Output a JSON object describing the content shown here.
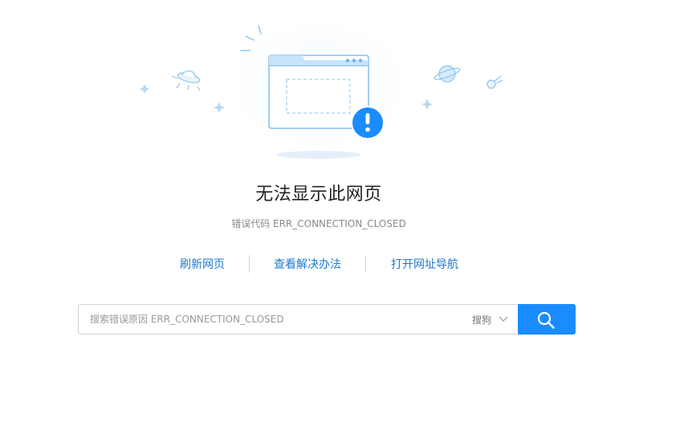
{
  "page": {
    "title": "无法显示此网页",
    "error_code": "错误代码 ERR_CONNECTION_CLOSED"
  },
  "actions": [
    {
      "label": "刷新网页"
    },
    {
      "label": "查看解决办法"
    },
    {
      "label": "打开网址导航"
    }
  ],
  "search": {
    "placeholder": "搜索错误原因 ERR_CONNECTION_CLOSED",
    "engine": "搜狗"
  },
  "colors": {
    "accent": "#1a8cff",
    "link": "#1d79d1",
    "illustration_stroke": "#6fb4ea"
  },
  "icons": {
    "illustration": "error-browser-window-icon",
    "alert": "exclamation-circle-icon",
    "engine_dropdown": "chevron-down-icon",
    "search": "search-icon"
  }
}
